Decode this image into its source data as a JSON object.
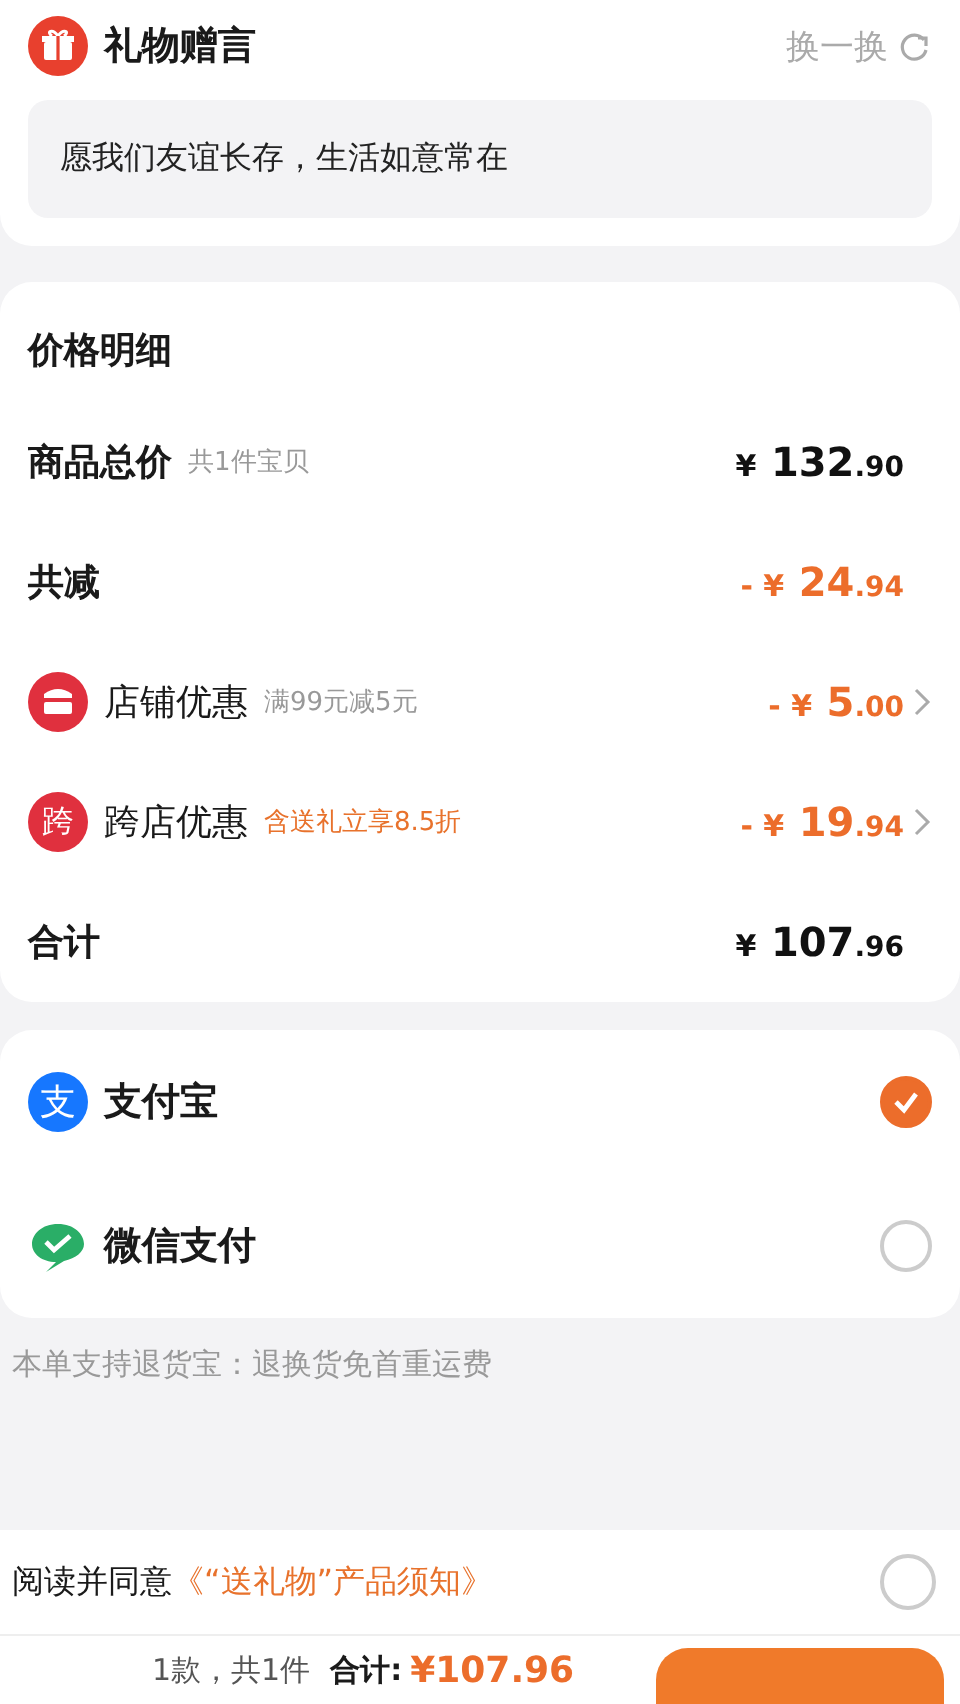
{
  "gift_message": {
    "title": "礼物赠言",
    "refresh_label": "换一换",
    "message": "愿我们友谊长存，生活如意常在"
  },
  "price_detail": {
    "title": "价格明细",
    "rows": [
      {
        "kind": "plain",
        "label": "商品总价",
        "note": "共1件宝贝",
        "note_highlighted": false,
        "amount": "¥ 132.90",
        "discount": false
      },
      {
        "kind": "plain",
        "label": "共减",
        "amount": "- ¥ 24.94",
        "discount": true
      },
      {
        "kind": "store",
        "label": "店铺优惠",
        "note": "满99元减5元",
        "note_highlighted": false,
        "amount": "- ¥ 5.00",
        "discount": true
      },
      {
        "kind": "badge",
        "badge": "跨",
        "label": "跨店优惠",
        "note": "含送礼立享8.5折",
        "note_highlighted": true,
        "amount": "- ¥ 19.94",
        "discount": true
      },
      {
        "kind": "plain",
        "label": "合计",
        "amount": "¥ 107.96",
        "discount": false
      }
    ]
  },
  "payment_methods": [
    {
      "kind": "badge",
      "badge": "支",
      "label": "支付宝",
      "selected": true
    },
    {
      "kind": "bubble",
      "label": "微信支付",
      "selected": false
    }
  ],
  "return_note": "本单支持退货宝：退换货免首重运费",
  "agreement": {
    "prefix": "阅读并同意",
    "link": "《“送礼物”产品须知》",
    "checked": false
  },
  "footer": {
    "count": "1款，共1件",
    "total_label": "合计:",
    "total": "¥107.96"
  }
}
